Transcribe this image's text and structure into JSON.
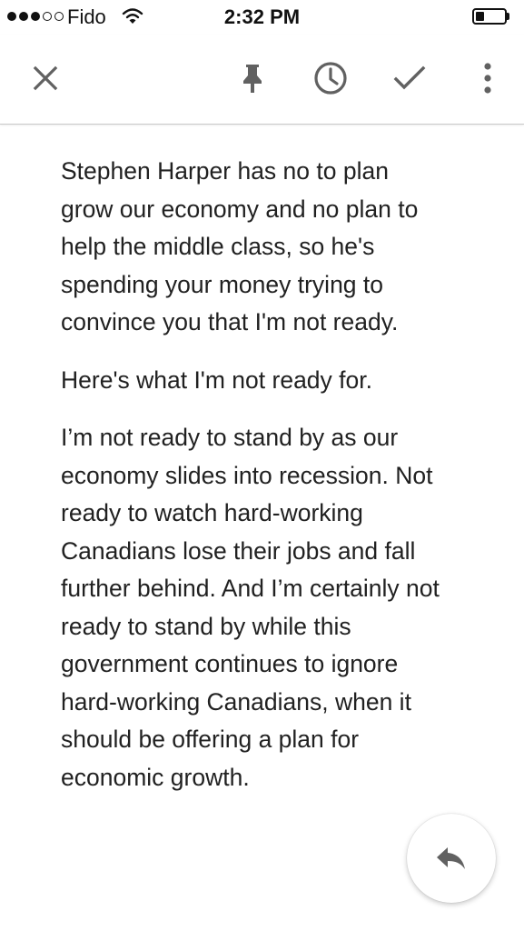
{
  "status_bar": {
    "carrier": "Fido",
    "time": "2:32 PM",
    "signal_bars_filled": 3,
    "signal_bars_total": 5,
    "battery_level": 0.3
  },
  "toolbar": {
    "icons": [
      "close-icon",
      "pin-icon",
      "snooze-clock-icon",
      "checkmark-icon",
      "more-vert-icon"
    ]
  },
  "email": {
    "paragraphs": [
      "Stephen Harper has no to plan grow our economy and no plan to help the middle class, so he's spending your money trying to convince you that I'm not ready.",
      "Here's what I'm not ready for.",
      "I’m not ready to stand by as our economy slides into recession. Not ready to watch hard-working Canadians lose their jobs and fall further behind. And I’m certainly not ready to stand by while this government continues to ignore hard-working Canadians, when it should be offering a plan for economic growth."
    ]
  },
  "fab": {
    "icon": "reply-icon"
  },
  "colors": {
    "text": "#212121",
    "icon": "#616161",
    "divider": "#c9c9c9"
  }
}
